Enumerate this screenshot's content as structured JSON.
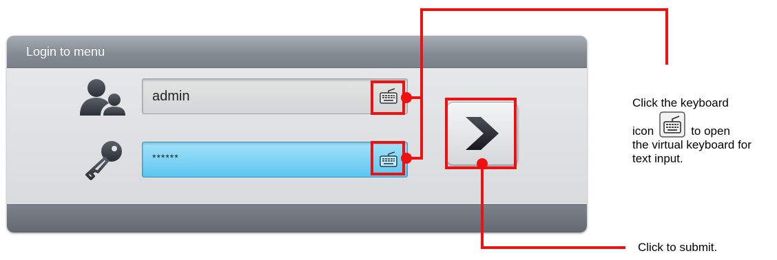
{
  "panel": {
    "title": "Login to menu"
  },
  "form": {
    "username_value": "admin",
    "password_value": "******"
  },
  "icons": {
    "user": "users-icon",
    "password": "key-icon",
    "keyboard": "keyboard-icon",
    "submit": "chevron-right-icon"
  },
  "annotations": {
    "keyboard_part1": "Click the keyboard",
    "keyboard_part2": "icon",
    "keyboard_part3": "to open",
    "keyboard_part4": "the virtual keyboard for text input.",
    "submit": "Click to submit."
  },
  "colors": {
    "highlight": "#ee1111",
    "password_field": "#5cc6ef",
    "header": "#868c94"
  }
}
